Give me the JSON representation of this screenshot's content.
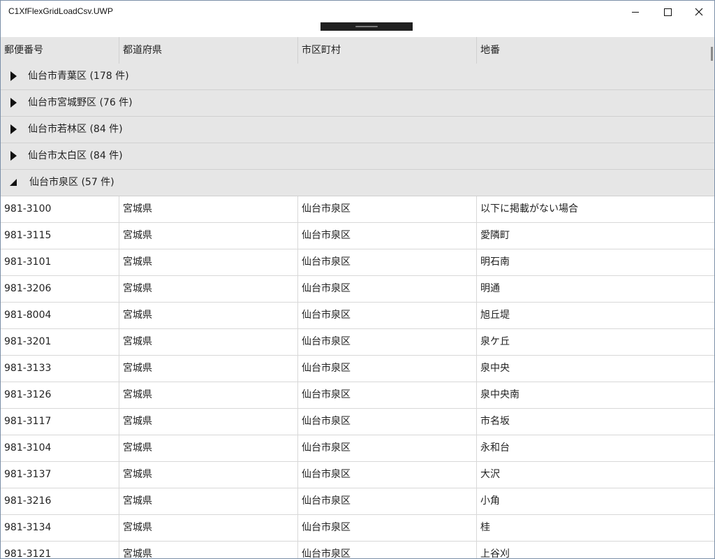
{
  "window": {
    "title": "C1XfFlexGridLoadCsv.UWP"
  },
  "grid": {
    "columns": [
      "郵便番号",
      "都道府県",
      "市区町村",
      "地番"
    ],
    "groups": [
      {
        "label": "仙台市青葉区 (178 件)",
        "expanded": false
      },
      {
        "label": "仙台市宮城野区 (76 件)",
        "expanded": false
      },
      {
        "label": "仙台市若林区 (84 件)",
        "expanded": false
      },
      {
        "label": "仙台市太白区 (84 件)",
        "expanded": false
      },
      {
        "label": "仙台市泉区 (57 件)",
        "expanded": true
      }
    ],
    "rows": [
      [
        "981-3100",
        "宮城県",
        "仙台市泉区",
        "以下に掲載がない場合"
      ],
      [
        "981-3115",
        "宮城県",
        "仙台市泉区",
        "愛隣町"
      ],
      [
        "981-3101",
        "宮城県",
        "仙台市泉区",
        "明石南"
      ],
      [
        "981-3206",
        "宮城県",
        "仙台市泉区",
        "明通"
      ],
      [
        "981-8004",
        "宮城県",
        "仙台市泉区",
        "旭丘堤"
      ],
      [
        "981-3201",
        "宮城県",
        "仙台市泉区",
        "泉ケ丘"
      ],
      [
        "981-3133",
        "宮城県",
        "仙台市泉区",
        "泉中央"
      ],
      [
        "981-3126",
        "宮城県",
        "仙台市泉区",
        "泉中央南"
      ],
      [
        "981-3117",
        "宮城県",
        "仙台市泉区",
        "市名坂"
      ],
      [
        "981-3104",
        "宮城県",
        "仙台市泉区",
        "永和台"
      ],
      [
        "981-3137",
        "宮城県",
        "仙台市泉区",
        "大沢"
      ],
      [
        "981-3216",
        "宮城県",
        "仙台市泉区",
        "小角"
      ],
      [
        "981-3134",
        "宮城県",
        "仙台市泉区",
        "桂"
      ],
      [
        "981-3121",
        "宮城県",
        "仙台市泉区",
        "上谷刈"
      ]
    ]
  }
}
